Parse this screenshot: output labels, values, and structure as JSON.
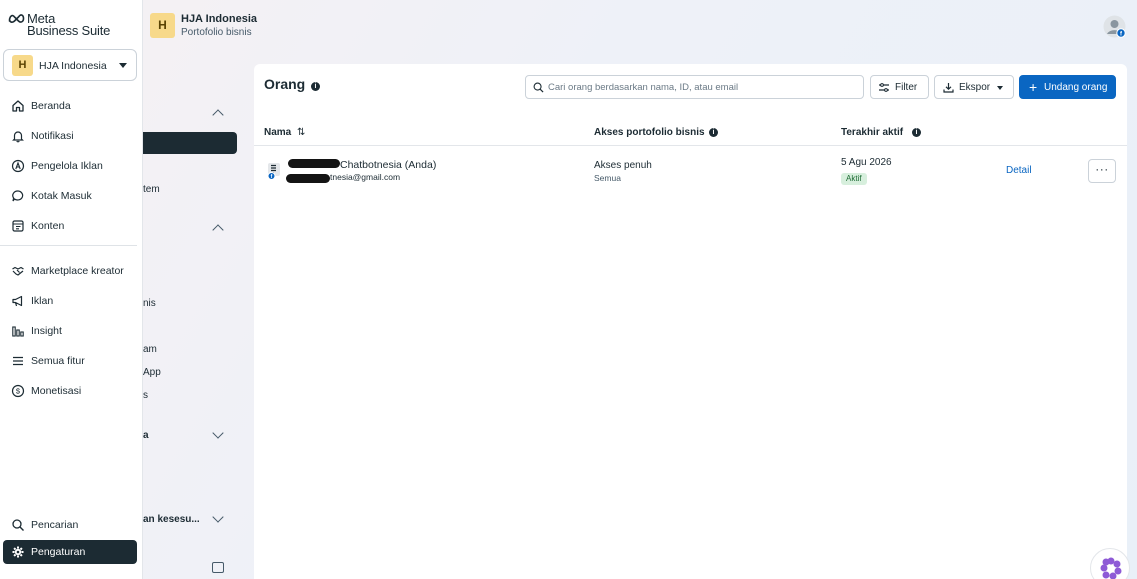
{
  "brand": {
    "line1": "Meta",
    "line2": "Business Suite",
    "accent": "#0a66c2"
  },
  "account_switcher": {
    "avatar_letter": "H",
    "name": "HJA Indonesia"
  },
  "nav": {
    "items": [
      {
        "label": "Beranda",
        "icon": "home-icon"
      },
      {
        "label": "Notifikasi",
        "icon": "bell-icon"
      },
      {
        "label": "Pengelola Iklan",
        "icon": "ads-manager-icon"
      },
      {
        "label": "Kotak Masuk",
        "icon": "inbox-icon"
      },
      {
        "label": "Konten",
        "icon": "content-icon"
      },
      {
        "label": "Marketplace kreator",
        "icon": "handshake-icon"
      },
      {
        "label": "Iklan",
        "icon": "megaphone-icon"
      },
      {
        "label": "Insight",
        "icon": "insights-icon"
      },
      {
        "label": "Semua fitur",
        "icon": "menu-icon"
      },
      {
        "label": "Monetisasi",
        "icon": "dollar-icon"
      }
    ],
    "bottom": [
      {
        "label": "Pencarian",
        "icon": "search-icon"
      },
      {
        "label": "Pengaturan",
        "icon": "gear-icon",
        "active": true
      }
    ]
  },
  "business": {
    "avatar_letter": "H",
    "name": "HJA Indonesia",
    "subtitle": "Portofolio bisnis",
    "fragments": [
      "tem",
      "nis",
      "am",
      "App",
      "s",
      "a",
      "an kesesu..."
    ]
  },
  "people": {
    "title": "Orang",
    "search_placeholder": "Cari orang berdasarkan nama, ID, atau email",
    "filter_label": "Filter",
    "export_label": "Ekspor",
    "invite_label": "Undang orang",
    "columns": {
      "name": "Nama",
      "access": "Akses portofolio bisnis",
      "last_active": "Terakhir aktif"
    },
    "rows": [
      {
        "name": "Chatbotnesia (Anda)",
        "email": "tnesia@gmail.com",
        "access": "Akses penuh",
        "access_scope": "Semua",
        "last_active": "5 Agu 2026",
        "status": "Aktif",
        "detail": "Detail",
        "more": "···"
      }
    ]
  }
}
